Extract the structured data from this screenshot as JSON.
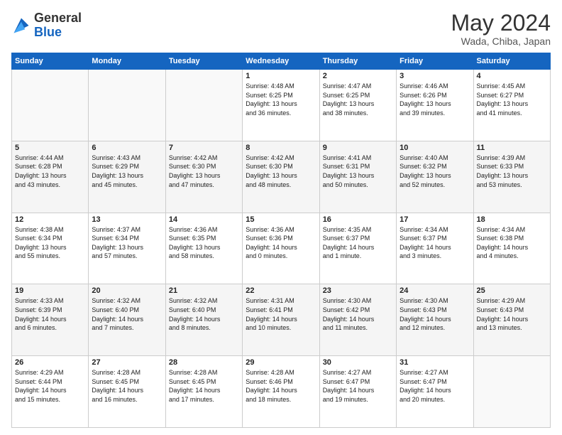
{
  "header": {
    "logo_general": "General",
    "logo_blue": "Blue",
    "month_title": "May 2024",
    "location": "Wada, Chiba, Japan"
  },
  "days_of_week": [
    "Sunday",
    "Monday",
    "Tuesday",
    "Wednesday",
    "Thursday",
    "Friday",
    "Saturday"
  ],
  "weeks": [
    [
      {
        "day": "",
        "info": ""
      },
      {
        "day": "",
        "info": ""
      },
      {
        "day": "",
        "info": ""
      },
      {
        "day": "1",
        "info": "Sunrise: 4:48 AM\nSunset: 6:25 PM\nDaylight: 13 hours\nand 36 minutes."
      },
      {
        "day": "2",
        "info": "Sunrise: 4:47 AM\nSunset: 6:25 PM\nDaylight: 13 hours\nand 38 minutes."
      },
      {
        "day": "3",
        "info": "Sunrise: 4:46 AM\nSunset: 6:26 PM\nDaylight: 13 hours\nand 39 minutes."
      },
      {
        "day": "4",
        "info": "Sunrise: 4:45 AM\nSunset: 6:27 PM\nDaylight: 13 hours\nand 41 minutes."
      }
    ],
    [
      {
        "day": "5",
        "info": "Sunrise: 4:44 AM\nSunset: 6:28 PM\nDaylight: 13 hours\nand 43 minutes."
      },
      {
        "day": "6",
        "info": "Sunrise: 4:43 AM\nSunset: 6:29 PM\nDaylight: 13 hours\nand 45 minutes."
      },
      {
        "day": "7",
        "info": "Sunrise: 4:42 AM\nSunset: 6:30 PM\nDaylight: 13 hours\nand 47 minutes."
      },
      {
        "day": "8",
        "info": "Sunrise: 4:42 AM\nSunset: 6:30 PM\nDaylight: 13 hours\nand 48 minutes."
      },
      {
        "day": "9",
        "info": "Sunrise: 4:41 AM\nSunset: 6:31 PM\nDaylight: 13 hours\nand 50 minutes."
      },
      {
        "day": "10",
        "info": "Sunrise: 4:40 AM\nSunset: 6:32 PM\nDaylight: 13 hours\nand 52 minutes."
      },
      {
        "day": "11",
        "info": "Sunrise: 4:39 AM\nSunset: 6:33 PM\nDaylight: 13 hours\nand 53 minutes."
      }
    ],
    [
      {
        "day": "12",
        "info": "Sunrise: 4:38 AM\nSunset: 6:34 PM\nDaylight: 13 hours\nand 55 minutes."
      },
      {
        "day": "13",
        "info": "Sunrise: 4:37 AM\nSunset: 6:34 PM\nDaylight: 13 hours\nand 57 minutes."
      },
      {
        "day": "14",
        "info": "Sunrise: 4:36 AM\nSunset: 6:35 PM\nDaylight: 13 hours\nand 58 minutes."
      },
      {
        "day": "15",
        "info": "Sunrise: 4:36 AM\nSunset: 6:36 PM\nDaylight: 14 hours\nand 0 minutes."
      },
      {
        "day": "16",
        "info": "Sunrise: 4:35 AM\nSunset: 6:37 PM\nDaylight: 14 hours\nand 1 minute."
      },
      {
        "day": "17",
        "info": "Sunrise: 4:34 AM\nSunset: 6:37 PM\nDaylight: 14 hours\nand 3 minutes."
      },
      {
        "day": "18",
        "info": "Sunrise: 4:34 AM\nSunset: 6:38 PM\nDaylight: 14 hours\nand 4 minutes."
      }
    ],
    [
      {
        "day": "19",
        "info": "Sunrise: 4:33 AM\nSunset: 6:39 PM\nDaylight: 14 hours\nand 6 minutes."
      },
      {
        "day": "20",
        "info": "Sunrise: 4:32 AM\nSunset: 6:40 PM\nDaylight: 14 hours\nand 7 minutes."
      },
      {
        "day": "21",
        "info": "Sunrise: 4:32 AM\nSunset: 6:40 PM\nDaylight: 14 hours\nand 8 minutes."
      },
      {
        "day": "22",
        "info": "Sunrise: 4:31 AM\nSunset: 6:41 PM\nDaylight: 14 hours\nand 10 minutes."
      },
      {
        "day": "23",
        "info": "Sunrise: 4:30 AM\nSunset: 6:42 PM\nDaylight: 14 hours\nand 11 minutes."
      },
      {
        "day": "24",
        "info": "Sunrise: 4:30 AM\nSunset: 6:43 PM\nDaylight: 14 hours\nand 12 minutes."
      },
      {
        "day": "25",
        "info": "Sunrise: 4:29 AM\nSunset: 6:43 PM\nDaylight: 14 hours\nand 13 minutes."
      }
    ],
    [
      {
        "day": "26",
        "info": "Sunrise: 4:29 AM\nSunset: 6:44 PM\nDaylight: 14 hours\nand 15 minutes."
      },
      {
        "day": "27",
        "info": "Sunrise: 4:28 AM\nSunset: 6:45 PM\nDaylight: 14 hours\nand 16 minutes."
      },
      {
        "day": "28",
        "info": "Sunrise: 4:28 AM\nSunset: 6:45 PM\nDaylight: 14 hours\nand 17 minutes."
      },
      {
        "day": "29",
        "info": "Sunrise: 4:28 AM\nSunset: 6:46 PM\nDaylight: 14 hours\nand 18 minutes."
      },
      {
        "day": "30",
        "info": "Sunrise: 4:27 AM\nSunset: 6:47 PM\nDaylight: 14 hours\nand 19 minutes."
      },
      {
        "day": "31",
        "info": "Sunrise: 4:27 AM\nSunset: 6:47 PM\nDaylight: 14 hours\nand 20 minutes."
      },
      {
        "day": "",
        "info": ""
      }
    ]
  ]
}
